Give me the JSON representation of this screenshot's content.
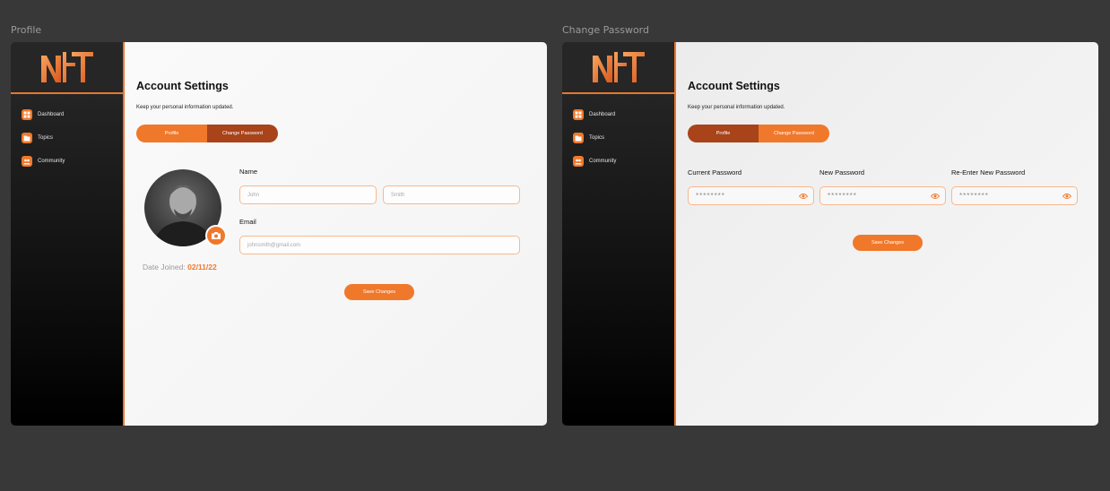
{
  "frames": {
    "profile": {
      "label": "Profile"
    },
    "password": {
      "label": "Change Password"
    }
  },
  "sidebar": {
    "items": [
      {
        "label": "Dashboard",
        "icon": "grid-icon"
      },
      {
        "label": "Topics",
        "icon": "folder-icon"
      },
      {
        "label": "Community",
        "icon": "group-icon"
      }
    ]
  },
  "settings": {
    "title": "Account Settings",
    "subtitle": "Keep your personal information updated.",
    "tabs": {
      "profile": "Profile",
      "password": "Change Password"
    }
  },
  "profile": {
    "name_label": "Name",
    "first_name_placeholder": "John",
    "last_name_placeholder": "Smith",
    "email_label": "Email",
    "email_placeholder": "johnsmith@gmail.com",
    "date_joined_label": "Date Joined:",
    "date_joined_value": "02/11/22",
    "save_label": "Save Changes"
  },
  "password": {
    "current_label": "Current Password",
    "new_label": "New Password",
    "reenter_label": "Re-Enter New Password",
    "masked": "********",
    "save_label": "Save Changes"
  },
  "colors": {
    "accent": "#f0782a",
    "accent_dark": "#a8431a",
    "sidebar_bg": "#1a1a1a",
    "canvas_bg": "#383838"
  }
}
